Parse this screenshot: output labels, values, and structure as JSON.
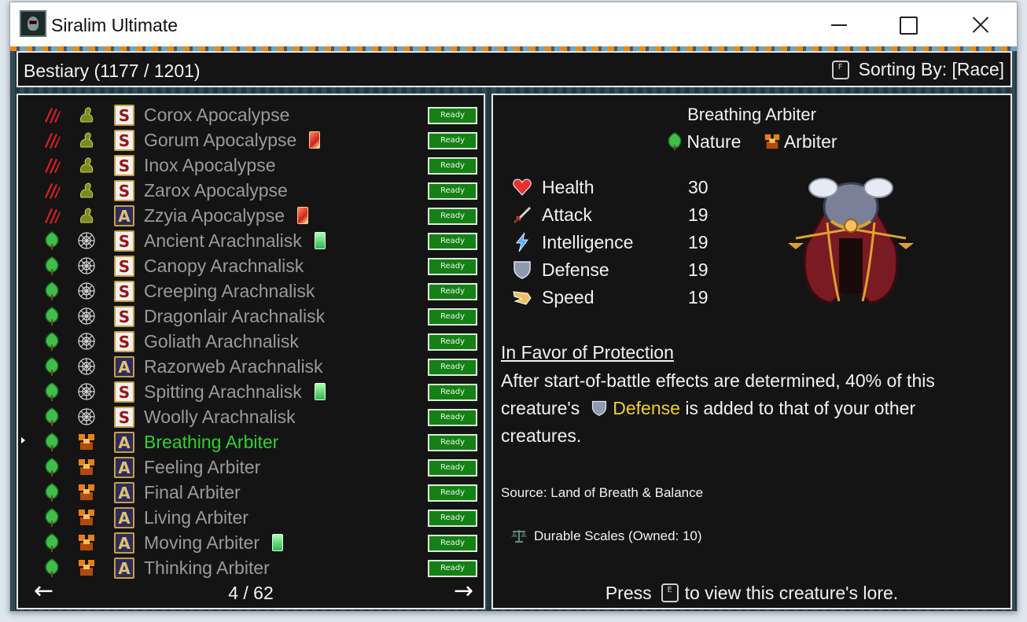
{
  "window": {
    "title": "Siralim Ultimate"
  },
  "header": {
    "bestiary_label": "Bestiary (1177 / 1201)",
    "sort_key": "F",
    "sort_label": "Sorting By: [Race]"
  },
  "list": {
    "ready_label": "Ready",
    "rows": [
      {
        "name": "Corox Apocalypse",
        "class": "chaos",
        "race": "apocalypse",
        "rank": "S",
        "card": "",
        "selected": false
      },
      {
        "name": "Gorum Apocalypse",
        "class": "chaos",
        "race": "apocalypse",
        "rank": "S",
        "card": "red",
        "selected": false
      },
      {
        "name": "Inox Apocalypse",
        "class": "chaos",
        "race": "apocalypse",
        "rank": "S",
        "card": "",
        "selected": false
      },
      {
        "name": "Zarox Apocalypse",
        "class": "chaos",
        "race": "apocalypse",
        "rank": "S",
        "card": "",
        "selected": false
      },
      {
        "name": "Zzyia Apocalypse",
        "class": "chaos",
        "race": "apocalypse",
        "rank": "A",
        "card": "red",
        "selected": false
      },
      {
        "name": "Ancient Arachnalisk",
        "class": "nature",
        "race": "arachnalisk",
        "rank": "S",
        "card": "green",
        "selected": false
      },
      {
        "name": "Canopy Arachnalisk",
        "class": "nature",
        "race": "arachnalisk",
        "rank": "S",
        "card": "",
        "selected": false
      },
      {
        "name": "Creeping Arachnalisk",
        "class": "nature",
        "race": "arachnalisk",
        "rank": "S",
        "card": "",
        "selected": false
      },
      {
        "name": "Dragonlair Arachnalisk",
        "class": "nature",
        "race": "arachnalisk",
        "rank": "S",
        "card": "",
        "selected": false
      },
      {
        "name": "Goliath Arachnalisk",
        "class": "nature",
        "race": "arachnalisk",
        "rank": "S",
        "card": "",
        "selected": false
      },
      {
        "name": "Razorweb Arachnalisk",
        "class": "nature",
        "race": "arachnalisk",
        "rank": "A",
        "card": "",
        "selected": false
      },
      {
        "name": "Spitting Arachnalisk",
        "class": "nature",
        "race": "arachnalisk",
        "rank": "S",
        "card": "green",
        "selected": false
      },
      {
        "name": "Woolly Arachnalisk",
        "class": "nature",
        "race": "arachnalisk",
        "rank": "S",
        "card": "",
        "selected": false
      },
      {
        "name": "Breathing Arbiter",
        "class": "nature",
        "race": "arbiter",
        "rank": "A",
        "card": "",
        "selected": true
      },
      {
        "name": "Feeling Arbiter",
        "class": "nature",
        "race": "arbiter",
        "rank": "A",
        "card": "",
        "selected": false
      },
      {
        "name": "Final Arbiter",
        "class": "nature",
        "race": "arbiter",
        "rank": "A",
        "card": "",
        "selected": false
      },
      {
        "name": "Living Arbiter",
        "class": "nature",
        "race": "arbiter",
        "rank": "A",
        "card": "",
        "selected": false
      },
      {
        "name": "Moving Arbiter",
        "class": "nature",
        "race": "arbiter",
        "rank": "A",
        "card": "green",
        "selected": false
      },
      {
        "name": "Thinking Arbiter",
        "class": "nature",
        "race": "arbiter",
        "rank": "A",
        "card": "",
        "selected": false
      }
    ]
  },
  "pager": {
    "prev_icon": "←",
    "next_icon": "→",
    "page_label": "4 / 62"
  },
  "detail": {
    "name": "Breathing Arbiter",
    "class_label": "Nature",
    "race_label": "Arbiter",
    "stats": [
      {
        "label": "Health",
        "value": "30",
        "icon": "heart-icon"
      },
      {
        "label": "Attack",
        "value": "19",
        "icon": "sword-icon"
      },
      {
        "label": "Intelligence",
        "value": "19",
        "icon": "lightning-icon"
      },
      {
        "label": "Defense",
        "value": "19",
        "icon": "shield-icon"
      },
      {
        "label": "Speed",
        "value": "19",
        "icon": "wing-icon"
      }
    ],
    "trait_title": "In Favor of Protection",
    "trait_line1": "After start-of-battle effects are determined, 40% of this",
    "trait_pre": "creature's",
    "trait_highlight": "Defense",
    "trait_post": " is added to that of your other",
    "trait_line3": "creatures.",
    "source": "Source: Land of Breath & Balance",
    "material": "Durable Scales (Owned: 10)",
    "lore_press": "Press",
    "lore_key": "E",
    "lore_rest": "to view this creature's lore."
  },
  "colors": {
    "selected_name": "#2fd22f",
    "unselected_name": "#9a9a9a",
    "highlight": "#f0d030",
    "ready_bg": "#158015"
  }
}
